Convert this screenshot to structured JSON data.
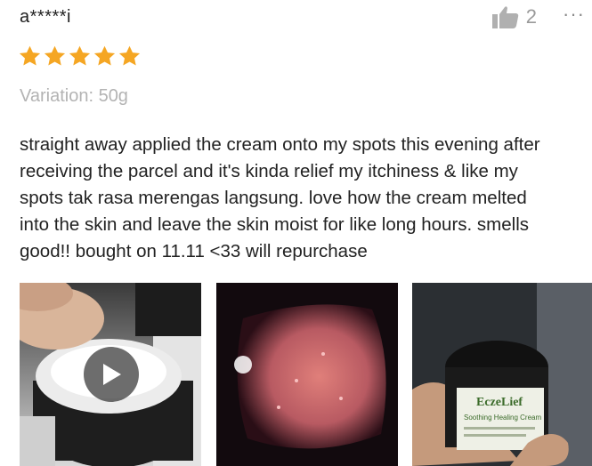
{
  "review": {
    "username": "a*****i",
    "likes_count": "2",
    "more_label": "···",
    "rating": 5,
    "variation": "Variation: 50g",
    "comment": "straight away applied the cream onto my spots this evening after\nreceiving the parcel and it's kinda relief my itchiness & like my\nspots tak rasa merengas langsung. love how the cream melted\ninto the skin and leave the skin moist for like long hours. smells\ngood!! bought on 11.11 <33 will repurchase"
  },
  "media": {
    "product_label": "EczeLief",
    "product_subtitle": "Soothing Healing Cream",
    "icons": [
      "thumbs-up-icon",
      "more-icon",
      "star-icon",
      "play-icon"
    ]
  },
  "colors": {
    "star": "#f5a623",
    "username": "#222222",
    "variation": "#b3b3b3",
    "meta": "#9a9a9a"
  }
}
